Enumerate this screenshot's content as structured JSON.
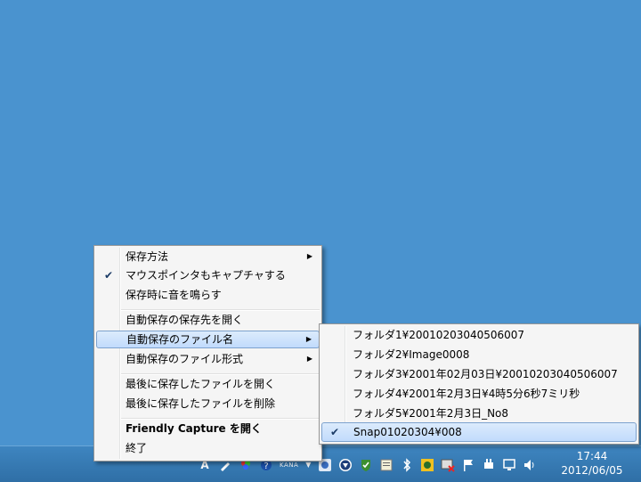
{
  "menu": {
    "items": [
      {
        "label": "保存方法"
      },
      {
        "label": "マウスポインタもキャプチャする"
      },
      {
        "label": "保存時に音を鳴らす"
      },
      {
        "label": "自動保存の保存先を開く"
      },
      {
        "label": "自動保存のファイル名"
      },
      {
        "label": "自動保存のファイル形式"
      },
      {
        "label": "最後に保存したファイルを開く"
      },
      {
        "label": "最後に保存したファイルを削除"
      },
      {
        "label": "Friendly Capture を開く"
      },
      {
        "label": "終了"
      }
    ]
  },
  "submenu": {
    "items": [
      {
        "label": "フォルダ1¥20010203040506007"
      },
      {
        "label": "フォルダ2¥Image0008"
      },
      {
        "label": "フォルダ3¥2001年02月03日¥20010203040506007"
      },
      {
        "label": "フォルダ4¥2001年2月3日¥4時5分6秒7ミリ秒"
      },
      {
        "label": "フォルダ5¥2001年2月3日_No8"
      },
      {
        "label": "Snap01020304¥008"
      }
    ]
  },
  "taskbar": {
    "ime_label": "KANA",
    "clock_time": "17:44",
    "clock_date": "2012/06/05",
    "tray_icons": [
      "ime-a-icon",
      "pen-icon",
      "color-icon",
      "help-icon",
      "ime-kana-icon",
      "dropdown-icon",
      "disc-icon",
      "download-icon",
      "shield-icon",
      "notepad-icon",
      "bluetooth-icon",
      "game-icon",
      "network-error-icon",
      "flag-icon",
      "plug-icon",
      "monitor-icon",
      "volume-icon"
    ]
  }
}
